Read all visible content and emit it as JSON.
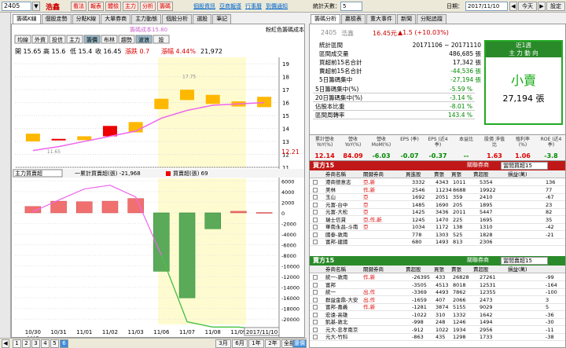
{
  "toolbar": {
    "code": "2405",
    "stock_name": "浩鑫",
    "buttons": [
      "看法",
      "報表",
      "體檢",
      "主力",
      "分析",
      "籌碼"
    ],
    "links": [
      "個股資訊",
      "亞商報導",
      "行事曆",
      "到價通知"
    ],
    "days_label": "統計天數：",
    "days_value": "5",
    "date_label": "日期：",
    "date_value": "2017/11/10",
    "today": "今天",
    "settings": "設定"
  },
  "left_tabs": [
    "籌碼K線",
    "個股走勢",
    "分點K線",
    "大單券商",
    "主力動態",
    "個股分析",
    "選股",
    "筆記"
  ],
  "chart": {
    "right_note": "粉紅色籌碼成本",
    "buttons": [
      "均線",
      "外資",
      "投信",
      "主力",
      "籌價",
      "布林",
      "趨勢",
      "波浪",
      "設"
    ],
    "cost_label": "籌碼成本15.80",
    "ohlc": {
      "o_lbl": "開",
      "o": "15.65",
      "h_lbl": "高",
      "h": "15.6",
      "l_lbl": "低",
      "l": "15.4",
      "c_lbl": "收",
      "c": "16.45",
      "chg": "漲跌 0.7",
      "chg_pct": "漲幅 4.44%",
      "vol": "21,972"
    },
    "price_ticks": [
      "19",
      "18",
      "17",
      "16",
      "15",
      "14",
      "13",
      "12",
      "11"
    ],
    "price_marker": "12.21",
    "annot_hi": "17.75",
    "annot_lo": "11.65",
    "dates": [
      "10/30",
      "10/31",
      "11/01",
      "11/02",
      "11/03",
      "11/06",
      "11/07",
      "11/08",
      "11/09"
    ],
    "year": "2017",
    "date_box": "2017/11/10",
    "indicator_select": "主力買賣超",
    "legend1": "一累計買賣超(張) -21,968",
    "legend2": "買賣超(張) 69",
    "ind_ticks": [
      "6000",
      "4000",
      "2000",
      "0",
      "-2000",
      "-4000",
      "-6000",
      "-8000",
      "-10000",
      "-12000",
      "-14000",
      "-16000",
      "-18000",
      "-20000"
    ]
  },
  "chart_data": {
    "type": "bar",
    "categories": [
      "10/30",
      "10/31",
      "11/01",
      "11/02",
      "11/03",
      "11/06",
      "11/07",
      "11/08",
      "11/09",
      "11/10"
    ],
    "candles": [
      {
        "o": 13.6,
        "c": 13.0
      },
      {
        "o": 13.2,
        "c": 13.2
      },
      {
        "o": 13.4,
        "c": 13.1
      },
      {
        "o": 13.4,
        "c": 14.2
      },
      {
        "o": 14.5,
        "c": 13.7
      },
      {
        "o": 16.3,
        "c": 15.5
      },
      {
        "o": 17.0,
        "c": 16.2
      },
      {
        "o": 16.6,
        "c": 15.9
      },
      {
        "o": 16.1,
        "c": 15.7
      },
      {
        "o": 16.45,
        "c": 15.65
      }
    ],
    "ma": [
      12.3,
      12.6,
      13.0,
      13.4,
      13.8,
      14.8,
      15.4,
      15.8,
      15.9,
      16.0
    ],
    "net": [
      1200,
      2200,
      2100,
      2200,
      2700,
      -11000,
      -16000,
      -3000,
      300,
      69
    ],
    "cum": [
      200,
      2400,
      4500,
      5200,
      3000,
      -8000,
      -20500,
      -21500,
      -21500,
      -21968
    ]
  },
  "right_tabs": [
    "籌碼分析",
    "贏檢表",
    "重大事件",
    "新聞",
    "分點追蹤"
  ],
  "summary": {
    "code": "2405",
    "name": "浩鑫",
    "price": "16.45元",
    "chg": "▲1.5 (+10.03%)",
    "rows": [
      {
        "k": "統計區間",
        "v": "20171106 ~ 20171110"
      },
      {
        "k": "區間成交量",
        "v": "486,685 張"
      },
      {
        "k": "買超前15名合計",
        "v": "17,342 張"
      },
      {
        "k": "賣超前15名合計",
        "v": "-44,536 張"
      },
      {
        "k": "5日籌碼集中",
        "v": "-27,194 張"
      }
    ],
    "rows2": [
      {
        "k": "5日籌碼集中(%)",
        "v": "-5.59 %"
      },
      {
        "k": "20日籌碼集中(%)",
        "v": "-3.14 %"
      },
      {
        "k": "佔股本比重",
        "v": "-8.01 %"
      },
      {
        "k": "區間周轉率",
        "v": "143.4 %"
      }
    ],
    "box_title1": "近1週",
    "box_title2": "主 力 動 向",
    "box_big": "小賣",
    "box_num": "27,194 張"
  },
  "fin": {
    "heads": [
      "累計營收 YoY(%)",
      "營收 YoY(%)",
      "營收 MoM(%)",
      "EPS (季)",
      "EPS (近4季)",
      "本益比",
      "股價 淨值比",
      "殖利率 (%)",
      "ROE (近4季)"
    ],
    "vals": [
      "12.14",
      "84.09",
      "-6.03",
      "-0.07",
      "-0.37",
      "--",
      "1.63",
      "1.06",
      "-3.8"
    ]
  },
  "buy": {
    "title": "買方15",
    "opt": "關聯券商",
    "sel": "當間買超15",
    "cols": [
      "券商名稱",
      "關鍵券商",
      "買進股",
      "賣張",
      "買張",
      "賣超股",
      "損益(萬)"
    ],
    "rows": [
      [
        "港商德意志",
        "亞,新",
        "3332",
        "4343",
        "1011",
        "5354",
        "136"
      ],
      [
        "美林",
        "作,新",
        "2546",
        "11234",
        "8688",
        "19922",
        "77"
      ],
      [
        "玉山",
        "亞",
        "1692",
        "2051",
        "359",
        "2410",
        "-67"
      ],
      [
        "元富-台中",
        "亞",
        "1485",
        "1690",
        "205",
        "1895",
        "23"
      ],
      [
        "元富-大松",
        "亞",
        "1425",
        "3436",
        "2011",
        "5447",
        "82"
      ],
      [
        "瑞士信貸",
        "亞,作,新",
        "1245",
        "1470",
        "225",
        "1695",
        "35"
      ],
      [
        "華南永昌-斗南",
        "亞",
        "1034",
        "1172",
        "138",
        "1310",
        "-42"
      ],
      [
        "國泰-敦南",
        "",
        "778",
        "1303",
        "525",
        "1828",
        "-21"
      ],
      [
        "富邦-建國",
        "",
        "680",
        "1493",
        "813",
        "2306",
        ""
      ]
    ]
  },
  "sell": {
    "title": "賣方15",
    "opt": "關聯券商",
    "sel": "當間賣超15",
    "cols": [
      "券商名稱",
      "關鍵券商",
      "賣超股",
      "買張",
      "賣張",
      "賣超股",
      "損益(萬)"
    ],
    "rows": [
      [
        "統一-敦南",
        "作,新",
        "-26395",
        "433",
        "26828",
        "27261",
        "-99"
      ],
      [
        "富邦",
        "",
        "-3505",
        "4513",
        "8018",
        "12531",
        "-164"
      ],
      [
        "統一",
        "出,作",
        "-3369",
        "4493",
        "7862",
        "12355",
        "-100"
      ],
      [
        "群益金鼎-大安",
        "出,作",
        "-1659",
        "407",
        "2066",
        "2473",
        "3"
      ],
      [
        "富邦-嘉義",
        "作,新",
        "-1281",
        "3874",
        "5155",
        "9029",
        "5"
      ],
      [
        "宏遠-高雄",
        "",
        "-1022",
        "310",
        "1332",
        "1642",
        "-36"
      ],
      [
        "凱基-敦北",
        "",
        "-998",
        "248",
        "1246",
        "1494",
        "-30"
      ],
      [
        "元大-忠孝南京",
        "",
        "-912",
        "1022",
        "1934",
        "2956",
        "-11"
      ],
      [
        "元大-竹科",
        "",
        "-863",
        "435",
        "1298",
        "1733",
        "-38"
      ]
    ]
  },
  "bottom": {
    "buttons": [
      "1",
      "2",
      "3",
      "4",
      "5",
      "6"
    ],
    "periods": [
      "3月",
      "6月",
      "1年",
      "2年",
      "全部"
    ],
    "zoom": "還價"
  }
}
